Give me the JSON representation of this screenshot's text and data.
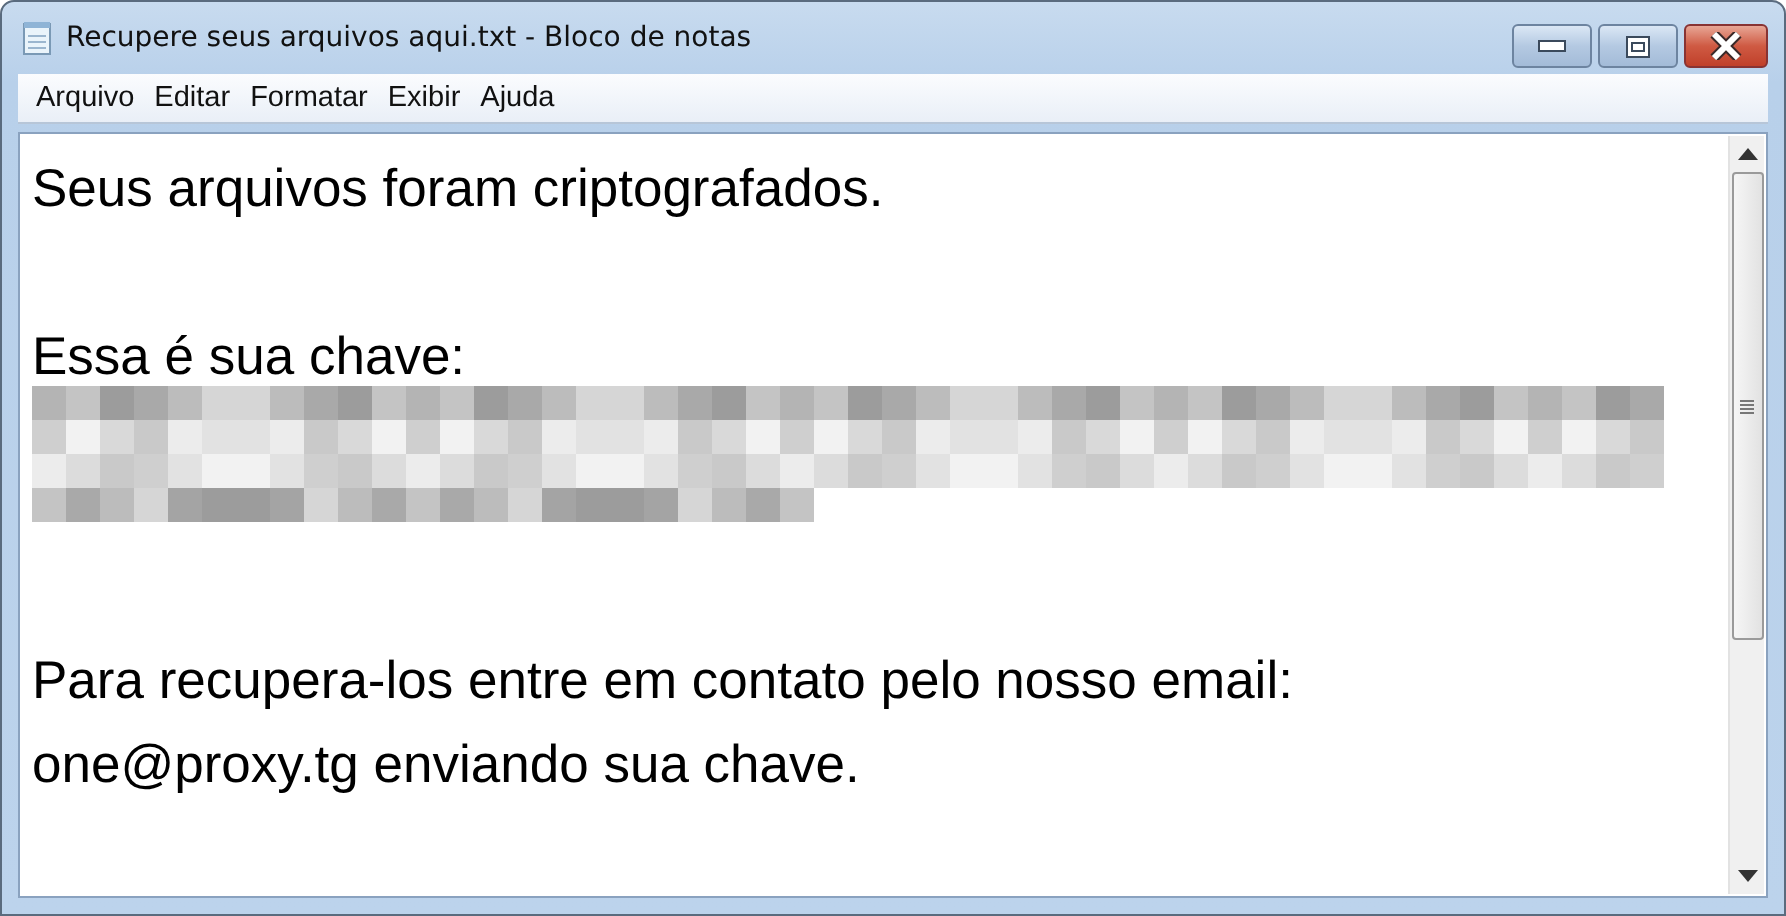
{
  "window": {
    "title": "Recupere seus arquivos aqui.txt - Bloco de notas"
  },
  "menu": [
    "Arquivo",
    "Editar",
    "Formatar",
    "Exibir",
    "Ajuda"
  ],
  "document": {
    "lines": [
      {
        "kind": "text",
        "text": "Seus arquivos foram criptografados."
      },
      {
        "kind": "blank"
      },
      {
        "kind": "text",
        "text": "Essa é sua chave:"
      },
      {
        "kind": "redacted"
      },
      {
        "kind": "blank"
      },
      {
        "kind": "text",
        "text": "Para recupera-los entre em contato pelo nosso email:"
      },
      {
        "kind": "text",
        "text": "one@proxy.tg enviando sua chave."
      }
    ]
  }
}
